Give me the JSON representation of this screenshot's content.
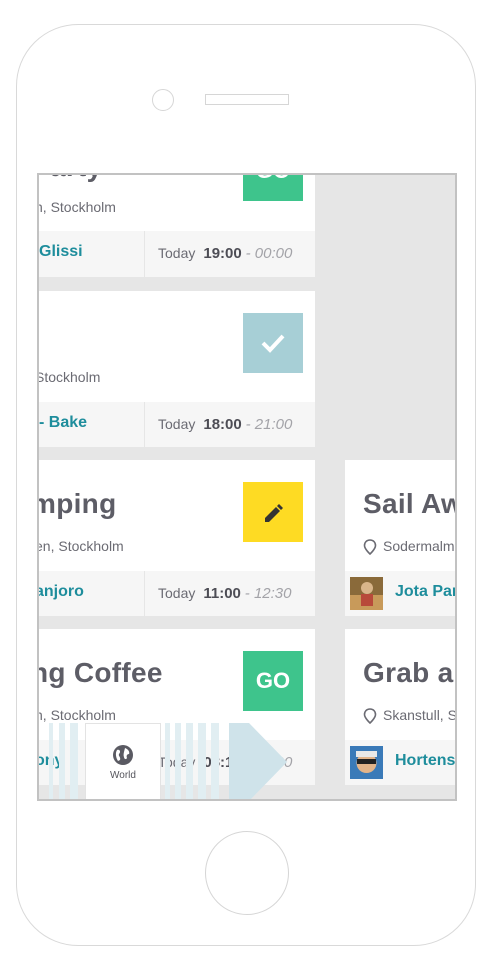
{
  "cards": [
    {
      "title": "Party",
      "location": "n, Stockholm",
      "host": "Glissi",
      "day": "Today",
      "start": "19:00",
      "end": "- 00:00",
      "badge": "GO"
    },
    {
      "title": "",
      "location": "Stockholm",
      "host": "Bake",
      "day": "Today",
      "start": "18:00",
      "end": "- 21:00",
      "badge": "check"
    },
    {
      "title": "mping",
      "location": "en, Stockholm",
      "host": "anjoro",
      "day": "Today",
      "start": "11:00",
      "end": "- 12:30",
      "badge": "edit"
    },
    {
      "title": "ng Coffee",
      "location": "n, Stockholm",
      "host": "ony",
      "day": "Today",
      "start": "08:10",
      "end": "- 09:00",
      "badge": "GO"
    },
    {
      "title": "Sail Aw",
      "location": "Sodermalm",
      "host": "Jota Par"
    },
    {
      "title": "Grab a",
      "location": "Skanstull, S",
      "host": "Hortens"
    }
  ],
  "tabbar": {
    "world_label": "World"
  },
  "colors": {
    "go": "#3ec48c",
    "check": "#a7cfd6",
    "edit": "#fedb23",
    "host": "#1e8d9c",
    "background": "#e6e6e6"
  }
}
